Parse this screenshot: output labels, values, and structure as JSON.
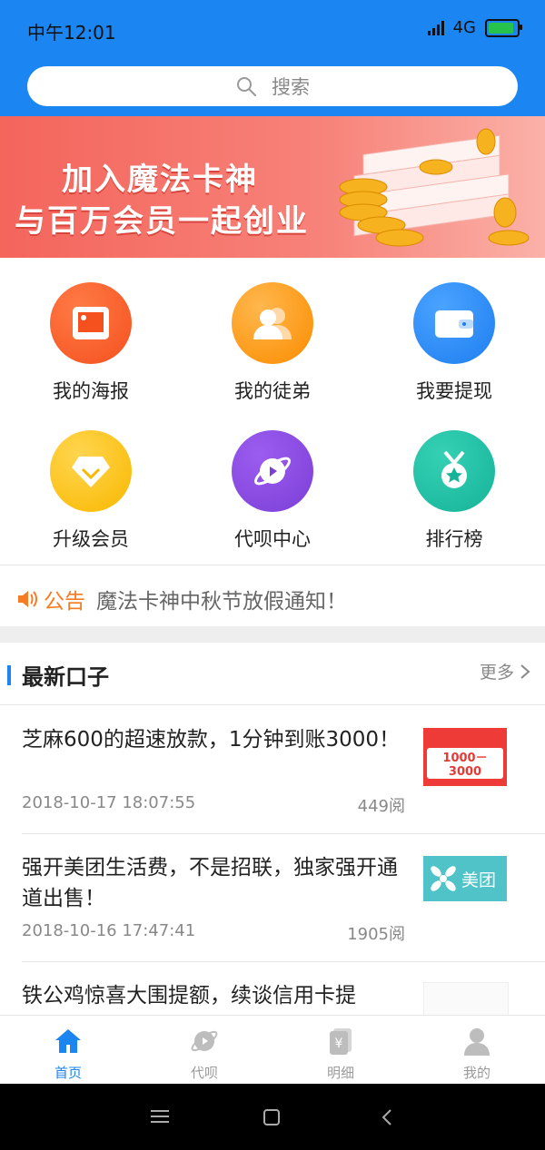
{
  "status": {
    "time": "中午12:01",
    "network": "4G"
  },
  "search": {
    "placeholder": "搜索"
  },
  "banner": {
    "line1": "加入魔法卡神",
    "line2": "与百万会员一起创业"
  },
  "grid": [
    {
      "label": "我的海报",
      "icon": "poster-icon",
      "color": "#f4511e"
    },
    {
      "label": "我的徒弟",
      "icon": "people-icon",
      "color": "#fb8c00"
    },
    {
      "label": "我要提现",
      "icon": "wallet-icon",
      "color": "#1e7ef0"
    },
    {
      "label": "升级会员",
      "icon": "diamond-icon",
      "color": "#f9b800"
    },
    {
      "label": "代呗中心",
      "icon": "planet-icon",
      "color": "#7b3fd6"
    },
    {
      "label": "排行榜",
      "icon": "medal-icon",
      "color": "#16b39a"
    }
  ],
  "notice": {
    "tag": "公告",
    "message": "魔法卡神中秋节放假通知！"
  },
  "section": {
    "title": "最新口子",
    "more": "更多"
  },
  "articles": [
    {
      "title": "芝麻600的超速放款，1分钟到账3000！",
      "date": "2018-10-17 18:07:55",
      "reads": "449阅",
      "thumb_text": "1000－3000"
    },
    {
      "title": "强开美团生活费，不是招联，独家强开通道出售！",
      "date": "2018-10-16 17:47:41",
      "reads": "1905阅",
      "thumb_text": "美团"
    },
    {
      "title": "铁公鸡惊喜大围提额，续谈信用卡提",
      "date": "",
      "reads": "",
      "thumb_text": ""
    }
  ],
  "nav": [
    {
      "label": "首页",
      "icon": "home-icon",
      "active": true
    },
    {
      "label": "代呗",
      "icon": "planet-icon",
      "active": false
    },
    {
      "label": "明细",
      "icon": "ledger-icon",
      "active": false
    },
    {
      "label": "我的",
      "icon": "user-icon",
      "active": false
    }
  ],
  "colors": {
    "primary": "#1b86f2",
    "notice": "#f57c23"
  }
}
